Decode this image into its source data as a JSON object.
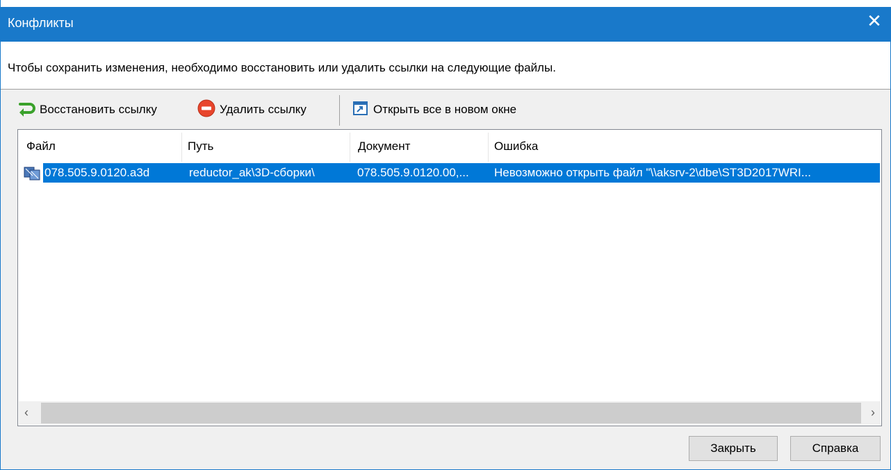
{
  "window": {
    "title": "Конфликты",
    "close_glyph": "✕"
  },
  "notice": {
    "text": "Чтобы сохранить изменения, необходимо восстановить или удалить ссылки на следующие файлы."
  },
  "toolbar": {
    "restore_label": "Восстановить ссылку",
    "restore_icon": "restore-arrow-icon",
    "delete_label": "Удалить ссылку",
    "delete_icon": "delete-circle-icon",
    "open_all_label": "Открыть все в новом окне",
    "open_all_icon": "new-window-icon"
  },
  "table": {
    "columns": [
      "Файл",
      "Путь",
      "Документ",
      "Ошибка"
    ],
    "rows": [
      {
        "file": "078.505.9.0120.a3d",
        "path": "reductor_ak\\3D-сборки\\",
        "document": "078.505.9.0120.00,...",
        "error": "Невозможно открыть файл \"\\\\aksrv-2\\dbe\\ST3D2017WRI...",
        "icon": "assembly-file-icon",
        "selected": true
      }
    ],
    "scroll_left_glyph": "‹",
    "scroll_right_glyph": "›"
  },
  "buttons": {
    "close_label": "Закрыть",
    "help_label": "Справка"
  },
  "colors": {
    "title_bar": "#1979ca",
    "selection": "#0078d7"
  }
}
